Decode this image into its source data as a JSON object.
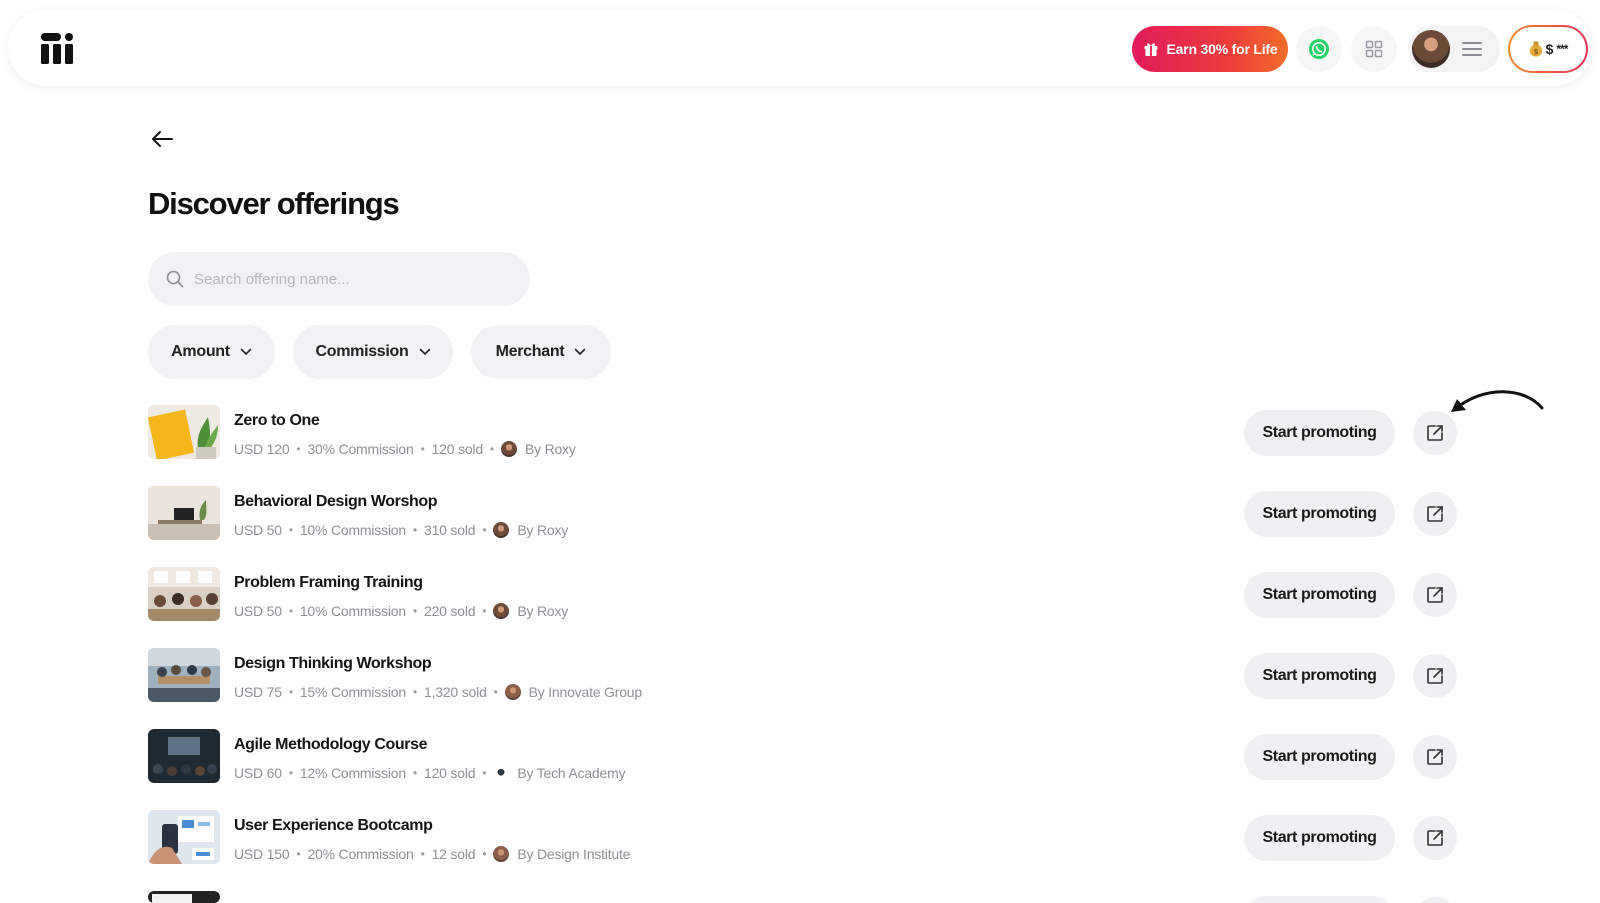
{
  "header": {
    "earn_label": "Earn 30% for Life",
    "balance_currency": "$",
    "balance_masked": "***",
    "icons": [
      "app-logo-icon",
      "gift-icon",
      "whatsapp-icon",
      "apps-grid-icon",
      "hamburger-menu-icon",
      "money-bag-icon"
    ],
    "colors": {
      "earn_start": "#e31b5c",
      "earn_end": "#f36d2a",
      "whatsapp": "#25d366"
    }
  },
  "page": {
    "title": "Discover offerings",
    "search_placeholder": "Search offering name..."
  },
  "filters": {
    "amount": "Amount",
    "commission": "Commission",
    "merchant": "Merchant"
  },
  "offerings": [
    {
      "title": "Zero to One",
      "price": "USD 120",
      "commission": "30% Commission",
      "sold": "120 sold",
      "by": "By Roxy",
      "action": "Start promoting"
    },
    {
      "title": "Behavioral Design Worshop",
      "price": "USD 50",
      "commission": "10% Commission",
      "sold": "310 sold",
      "by": "By Roxy",
      "action": "Start promoting"
    },
    {
      "title": "Problem Framing Training",
      "price": "USD 50",
      "commission": "10% Commission",
      "sold": "220 sold",
      "by": "By Roxy",
      "action": "Start promoting"
    },
    {
      "title": "Design Thinking Workshop",
      "price": "USD 75",
      "commission": "15% Commission",
      "sold": "1,320 sold",
      "by": "By Innovate Group",
      "action": "Start promoting"
    },
    {
      "title": "Agile Methodology Course",
      "price": "USD 60",
      "commission": "12% Commission",
      "sold": "120 sold",
      "by": "By Tech Academy",
      "action": "Start promoting"
    },
    {
      "title": "User Experience Bootcamp",
      "price": "USD 150",
      "commission": "20% Commission",
      "sold": "12 sold",
      "by": "By Design Institute",
      "action": "Start promoting"
    }
  ]
}
